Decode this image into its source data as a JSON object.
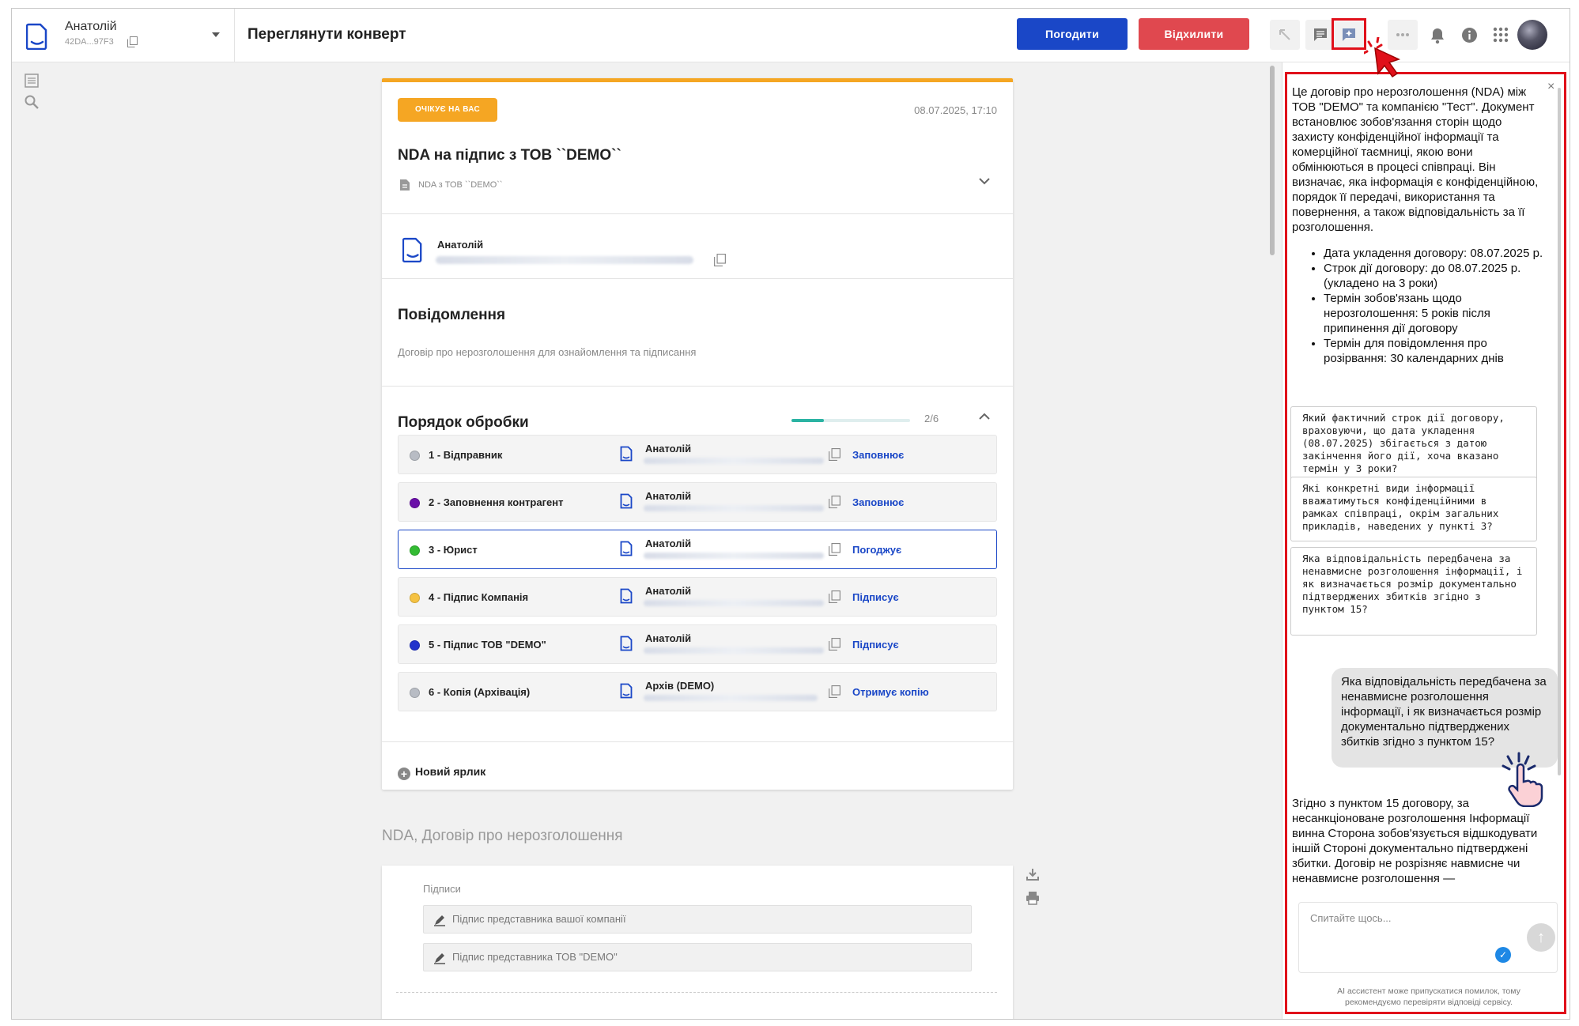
{
  "account": {
    "name": "Анатолій",
    "id": "42DA...97F3"
  },
  "page_title": "Переглянути конверт",
  "actions": {
    "approve": "Погодити",
    "reject": "Відхилити"
  },
  "toolbar_icons": [
    "expand-icon",
    "comment-icon",
    "ai-assistant-icon",
    "more-icon",
    "bell-icon",
    "info-icon",
    "apps-icon"
  ],
  "envelope": {
    "status": "ОЧІКУЄ НА ВАС",
    "date": "08.07.2025, 17:10",
    "title": "NDA на підпис з ТОВ ``DEMO``",
    "subtitle": "NDA з ТОВ ``DEMO``",
    "sender": "Анатолій",
    "message_heading": "Повідомлення",
    "message": "Договір про нерозголошення для ознайомлення та підписання",
    "order_heading": "Порядок обробки",
    "progress_label": "2/6",
    "progress_value": 0.27,
    "steps": [
      {
        "name": "1 - Відправник",
        "person": "Анатолій",
        "role": "Заповнює",
        "color": "#b8bcc4"
      },
      {
        "name": "2 - Заповнення контрагент",
        "person": "Анатолій",
        "role": "Заповнює",
        "color": "#6a0fa8"
      },
      {
        "name": "3 - Юрист",
        "person": "Анатолій",
        "role": "Погоджує",
        "color": "#33bb33"
      },
      {
        "name": "4 - Підпис Компанія",
        "person": "Анатолій",
        "role": "Підписує",
        "color": "#f5c242"
      },
      {
        "name": "5 - Підпис ТОВ \"DEMO\"",
        "person": "Анатолій",
        "role": "Підписує",
        "color": "#2233cc"
      },
      {
        "name": "6 - Копія (Архівація)",
        "person": "Архів (DEMO)",
        "role": "Отримує копію",
        "color": "#b8bcc4"
      }
    ],
    "new_label": "Новий ярлик"
  },
  "document": {
    "section_title": "NDA, Договір про нерозголошення",
    "signatures_label": "Підписи",
    "sig1": "Підпис представника вашої компанії",
    "sig2": "Підпис представника ТОВ \"DEMO\""
  },
  "ai": {
    "intro": "Це договір про нерозголошення (NDA) між ТОВ \"DEMO\" та компанією \"Тест\". Документ встановлює зобов'язання сторін щодо захисту конфіденційної інформації та комерційної таємниці, якою вони обмінюються в процесі співпраці. Він визначає, яка інформація є конфіденційною, порядок її передачі, використання та повернення, а також відповідальність за її розголошення.",
    "bullets": [
      "Дата укладення договору: 08.07.2025 р.",
      "Строк дії договору: до 08.07.2025 р. (укладено на 3 роки)",
      "Термін зобов'язань щодо нерозголошення: 5 років після припинення дії договору",
      "Термін для повідомлення про розірвання: 30 календарних днів"
    ],
    "suggestions": [
      "Який фактичний строк дії договору, враховуючи, що дата укладення (08.07.2025) збігається з датою закінчення його дії, хоча вказано термін у 3 роки?",
      "Які конкретні види інформації вважатимуться конфіденційними в рамках співпраці, окрім загальних прикладів, наведених у пункті 3?",
      "Яка відповідальність передбачена за ненавмисне розголошення інформації, і як визначається розмір документально підтверджених збитків згідно з пунктом 15?"
    ],
    "user_question": "Яка відповідальність передбачена за ненавмисне розголошення інформації, і як визначається розмір документально підтверджених збитків згідно з пунктом 15?",
    "answer": "Згідно з пунктом 15 договору, за несанкціоноване розголошення Інформації винна Сторона зобов'язується відшкодувати іншій Стороні документально підтверджені збитки. Договір не розрізняє навмисне чи ненавмисне розголошення —",
    "input_placeholder": "Спитайте щось...",
    "disclaimer": "AI ассистент може припускатися помилок, тому рекомендуємо перевіряти відповіді сервісу."
  },
  "colors": {
    "primary": "#1a47c7",
    "danger": "#e0484f",
    "status": "#f5a623",
    "highlight": "#e0101a"
  }
}
